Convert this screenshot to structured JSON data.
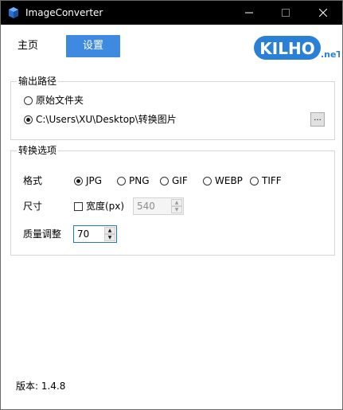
{
  "window": {
    "title": "ImageConverter"
  },
  "nav": {
    "home": "主页",
    "settings": "设置"
  },
  "logo": {
    "text": "KILHO",
    "suffix": ".neT"
  },
  "output": {
    "legend": "输出路径",
    "options": [
      {
        "label": "原始文件夹",
        "selected": false
      },
      {
        "label": "C:\\Users\\XU\\Desktop\\转换图片",
        "selected": true
      }
    ],
    "browse_label": "..."
  },
  "convert": {
    "legend": "转换选项",
    "format_label": "格式",
    "formats": [
      {
        "label": "JPG",
        "selected": true
      },
      {
        "label": "PNG",
        "selected": false
      },
      {
        "label": "GIF",
        "selected": false
      },
      {
        "label": "WEBP",
        "selected": false
      },
      {
        "label": "TIFF",
        "selected": false
      }
    ],
    "size_label": "尺寸",
    "width_checkbox": "宽度(px)",
    "width_checked": false,
    "width_value": "540",
    "quality_label": "质量调整",
    "quality_value": "70"
  },
  "version": "版本: 1.4.8",
  "colors": {
    "titlebar": "#000000",
    "accent": "#3e8ae0",
    "logo": "#2a7fd6"
  }
}
